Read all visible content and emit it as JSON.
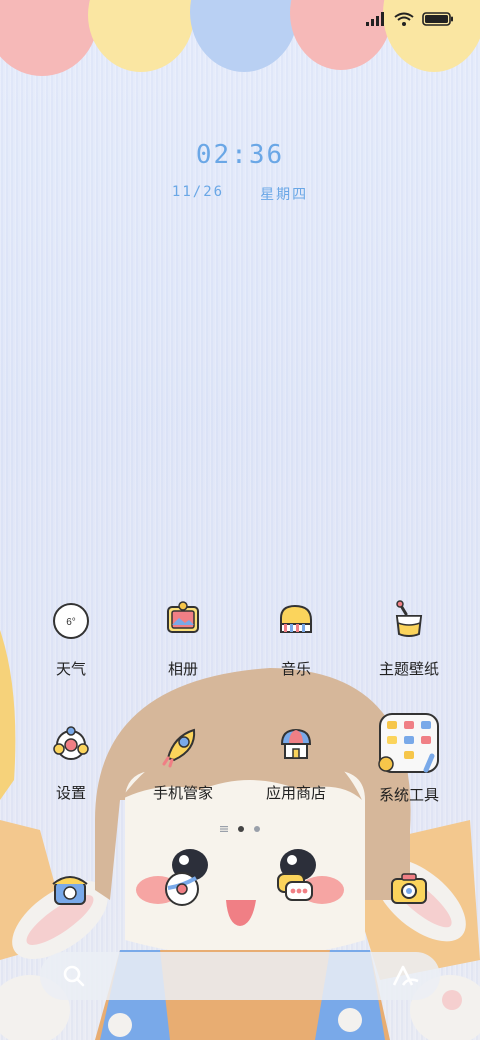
{
  "clock": {
    "time": "02:36",
    "date": "11/26",
    "weekday": "星期四"
  },
  "weather_widget": {
    "temp": "6°"
  },
  "apps_row1": [
    {
      "label": "天气",
      "icon": "weather-icon"
    },
    {
      "label": "相册",
      "icon": "gallery-icon"
    },
    {
      "label": "音乐",
      "icon": "music-icon"
    },
    {
      "label": "主题壁纸",
      "icon": "themes-icon"
    }
  ],
  "apps_row2": [
    {
      "label": "设置",
      "icon": "settings-icon"
    },
    {
      "label": "手机管家",
      "icon": "security-icon"
    },
    {
      "label": "应用商店",
      "icon": "app-store-icon"
    },
    {
      "label": "系统工具",
      "icon": "folder-icon"
    }
  ],
  "dock": [
    {
      "icon": "phone-icon"
    },
    {
      "icon": "browser-icon"
    },
    {
      "icon": "messages-icon"
    },
    {
      "icon": "camera-icon"
    }
  ],
  "page_indicator": {
    "pages": 2,
    "active": 1
  }
}
